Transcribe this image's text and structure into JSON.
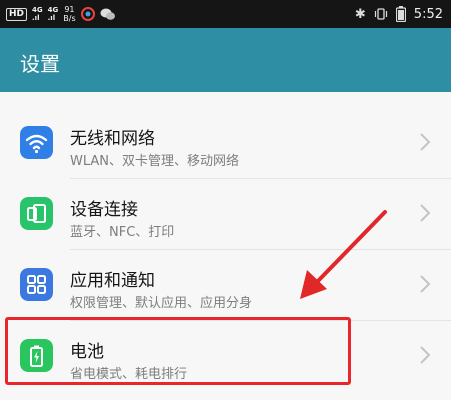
{
  "status_bar": {
    "hd": "HD",
    "signal1": "4G\n.ıl",
    "signal2": "4G\n.ıl",
    "speed_value": "91",
    "speed_unit": "B/s",
    "time": "5:52"
  },
  "app_bar": {
    "title": "设置"
  },
  "items": [
    {
      "title": "无线和网络",
      "subtitle": "WLAN、双卡管理、移动网络",
      "icon": "wifi-icon",
      "color": "#2f7fe6"
    },
    {
      "title": "设备连接",
      "subtitle": "蓝牙、NFC、打印",
      "icon": "device-connection-icon",
      "color": "#27c46b"
    },
    {
      "title": "应用和通知",
      "subtitle": "权限管理、默认应用、应用分身",
      "icon": "apps-icon",
      "color": "#3b78e0"
    },
    {
      "title": "电池",
      "subtitle": "省电模式、耗电排行",
      "icon": "battery-icon",
      "color": "#29c55e"
    }
  ],
  "colors": {
    "app_bar": "#2e8fa4",
    "highlight": "#e8262b",
    "arrow": "#e02828"
  }
}
